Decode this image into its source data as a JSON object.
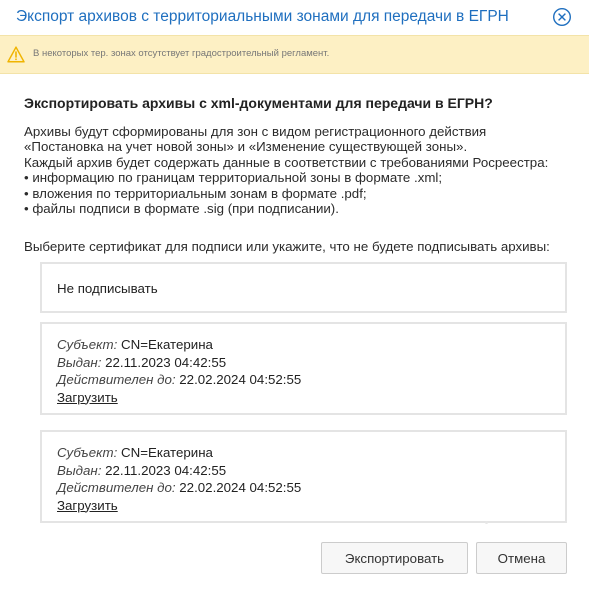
{
  "dialog": {
    "title": "Экспорт архивов с территориальными зонами для передачи в ЕГРН",
    "close_icon": "close-circle-icon",
    "accent_color": "#1f6fbf"
  },
  "warning": {
    "icon": "warning-triangle-icon",
    "text": "В некоторых тер. зонах отсутствует градостроительный регламент.",
    "background": "#fdf0c4",
    "icon_color": "#f0b400"
  },
  "content": {
    "heading": "Экспортировать архивы с xml-документами для передачи в ЕГРН?",
    "description_lines": [
      "Архивы будут сформированы для зон с видом регистрационного действия",
      "«Постановка на учет новой зоны» и «Изменение существующей зоны».",
      "Каждый архив будет содержать данные в соответствии с требованиями Росреестра:",
      "• информацию по границам территориальной зоны в формате .xml;",
      "• вложения по территориальным зонам в формате .pdf;",
      "• файлы подписи в формате .sig (при подписании)."
    ],
    "prompt": "Выберите сертификат для подписи или укажите, что не будете подписывать архивы:"
  },
  "options": {
    "no_sign_label": "Не подписывать",
    "certificates": [
      {
        "subject_label": "Субъект:",
        "subject_value": " CN=Екатерина",
        "issued_label": "Выдан:",
        "issued_value": " 22.11.2023 04:42:55",
        "valid_label": "Действителен до:",
        "valid_value": " 22.02.2024 04:52:55",
        "link": "Загрузить"
      },
      {
        "subject_label": "Субъект:",
        "subject_value": " CN=Екатерина",
        "issued_label": "Выдан:",
        "issued_value": " 22.11.2023 04:42:55",
        "valid_label": "Действителен до:",
        "valid_value": " 22.02.2024 04:52:55",
        "link": "Загрузить"
      }
    ]
  },
  "footer": {
    "export_label": "Экспортировать",
    "cancel_label": "Отмена"
  }
}
